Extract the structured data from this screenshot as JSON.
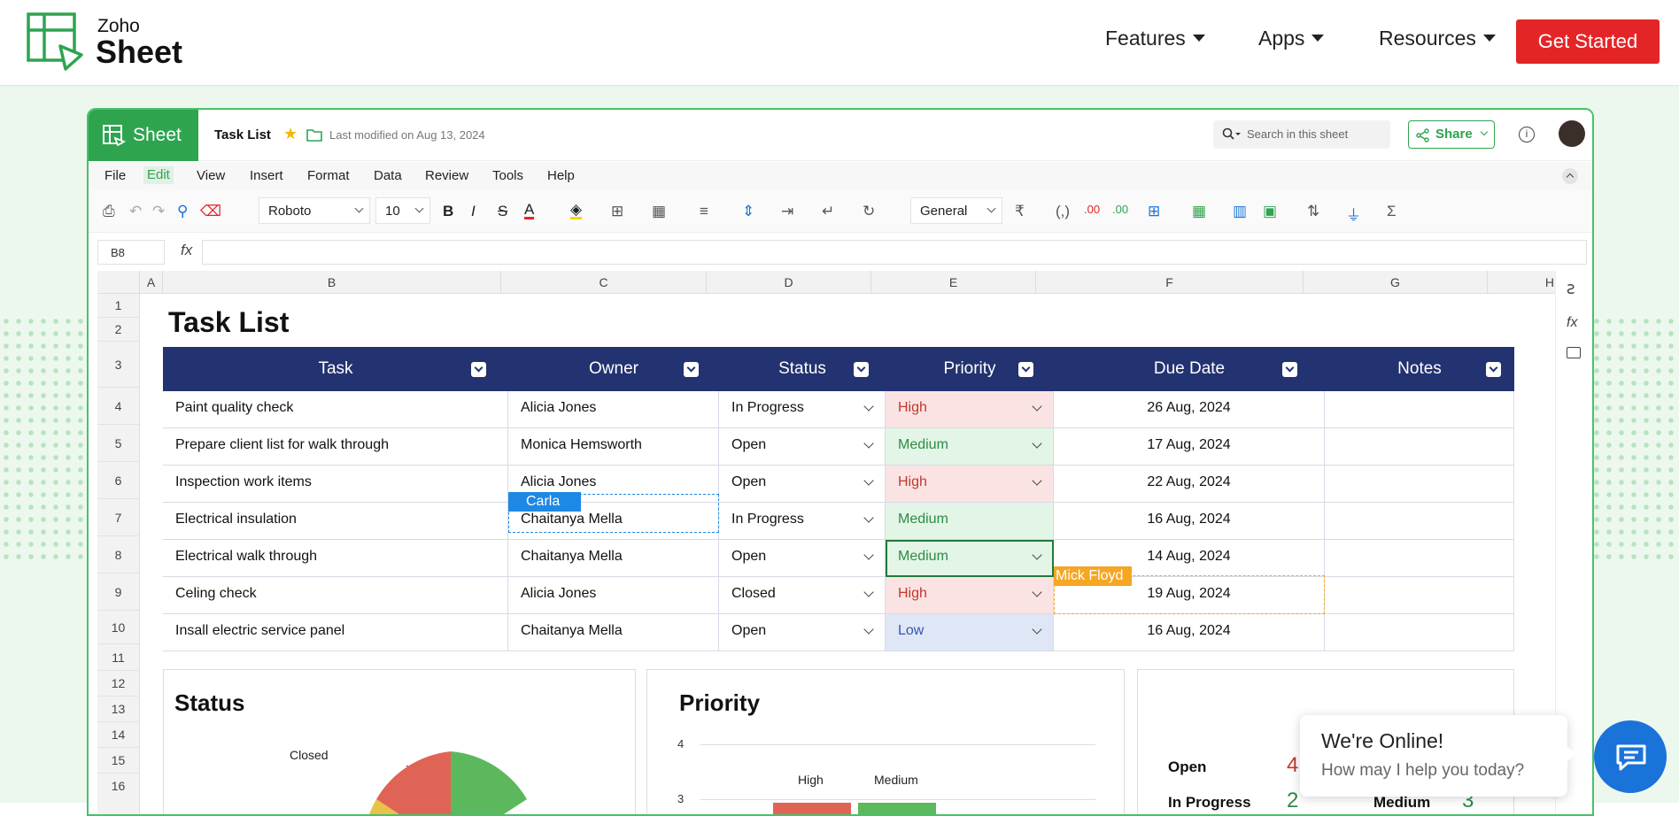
{
  "nav": {
    "logo_top": "Zoho",
    "logo_bottom": "Sheet",
    "items": [
      "Features",
      "Apps",
      "Resources"
    ],
    "cta": "Get Started"
  },
  "app": {
    "brand": "Sheet",
    "doc_title": "Task List",
    "modified": "Last modified on Aug 13, 2024",
    "search_placeholder": "Search in this sheet",
    "share": "Share",
    "menus": [
      "File",
      "Edit",
      "View",
      "Insert",
      "Format",
      "Data",
      "Review",
      "Tools",
      "Help"
    ],
    "font": "Roboto",
    "font_size": "10",
    "number_format": "General",
    "cell_ref": "B8",
    "fx": "fx"
  },
  "columns": [
    "A",
    "B",
    "C",
    "D",
    "E",
    "F",
    "G",
    "H"
  ],
  "rows": [
    "1",
    "2",
    "3",
    "4",
    "5",
    "6",
    "7",
    "8",
    "9",
    "10",
    "11",
    "12",
    "13",
    "14",
    "15",
    "16"
  ],
  "sheet_title": "Task List",
  "table": {
    "headers": [
      "Task",
      "Owner",
      "Status",
      "Priority",
      "Due Date",
      "Notes"
    ],
    "rows": [
      {
        "task": "Paint quality check",
        "owner": "Alicia Jones",
        "status": "In Progress",
        "priority": "High",
        "due": "26 Aug, 2024"
      },
      {
        "task": "Prepare client list for walk through",
        "owner": "Monica Hemsworth",
        "status": "Open",
        "priority": "Medium",
        "due": "17 Aug, 2024"
      },
      {
        "task": "Inspection work items",
        "owner": "Alicia Jones",
        "status": "Open",
        "priority": "High",
        "due": "22 Aug, 2024"
      },
      {
        "task": "Electrical insulation",
        "owner": "Chaitanya Mella",
        "status": "In Progress",
        "priority": "Medium",
        "due": "16 Aug, 2024"
      },
      {
        "task": "Electrical walk through",
        "owner": "Chaitanya Mella",
        "status": "Open",
        "priority": "Medium",
        "due": "14 Aug, 2024"
      },
      {
        "task": "Celing check",
        "owner": "Alicia Jones",
        "status": "Closed",
        "priority": "High",
        "due": "19 Aug, 2024"
      },
      {
        "task": "Insall electric service panel",
        "owner": "Chaitanya Mella",
        "status": "Open",
        "priority": "Low",
        "due": "16 Aug, 2024"
      }
    ]
  },
  "collaborators": {
    "carla": "Carla",
    "mick": "Mick Floyd"
  },
  "charts": {
    "status_title": "Status",
    "status_label_closed": "Closed",
    "priority_title": "Priority",
    "priority_labels": [
      "High",
      "Medium"
    ],
    "priority_ticks": [
      "4",
      "3"
    ],
    "summary": [
      {
        "label": "Open",
        "value": "4"
      },
      {
        "label": "In Progress",
        "value": "2"
      }
    ],
    "summary_right": [
      {
        "label": "Medium",
        "value": "3"
      }
    ]
  },
  "chat": {
    "title": "We're Online!",
    "subtitle": "How may I help you today?"
  },
  "colors": {
    "brand_green": "#2ea44f",
    "header_navy": "#233270",
    "cta_red": "#e42527",
    "carla_blue": "#1e88e5",
    "mick_orange": "#f5a623"
  }
}
